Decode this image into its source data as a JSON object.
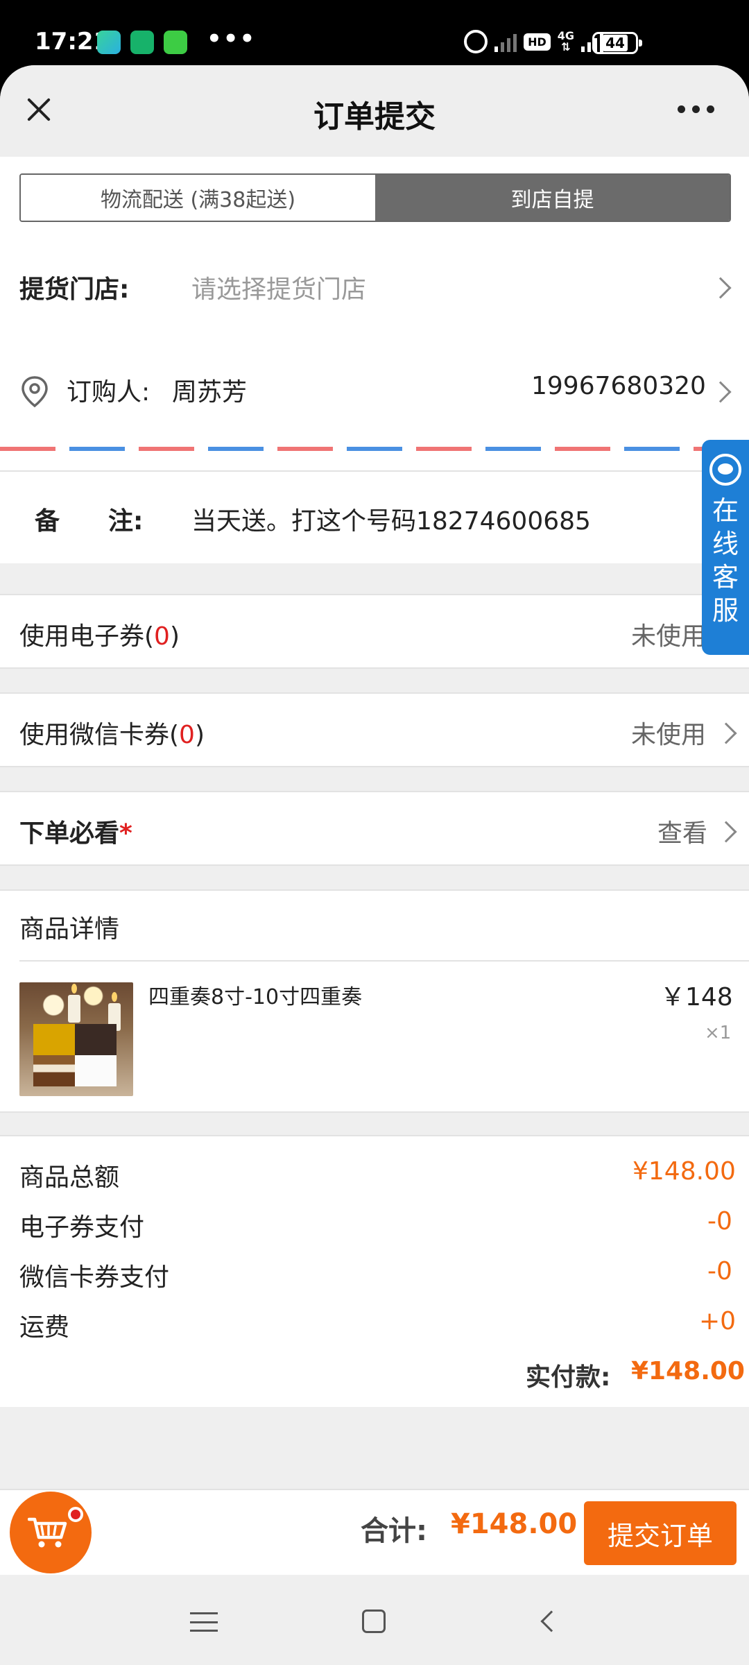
{
  "status_bar": {
    "time": "17:21",
    "more_glyph": "•••",
    "hd": "HD",
    "network": "4G",
    "battery": "44"
  },
  "header": {
    "title": "订单提交"
  },
  "delivery_tabs": [
    {
      "label": "物流配送 (满38起送)",
      "active": false
    },
    {
      "label": "到店自提",
      "active": true
    }
  ],
  "pickup_store": {
    "label": "提货门店:",
    "placeholder": "请选择提货门店"
  },
  "orderer": {
    "label": "订购人:",
    "name": "周苏芳",
    "phone": "19967680320"
  },
  "note": {
    "label_1": "备",
    "label_2": "注:",
    "value": "当天送。打这个号码18274600685"
  },
  "e_coupon": {
    "label": "使用电子券(",
    "count": "0",
    "close": ")",
    "status": "未使用"
  },
  "wechat_card": {
    "label": "使用微信卡券(",
    "count": "0",
    "close": ")",
    "status": "未使用"
  },
  "must_read": {
    "label": "下单必看",
    "star": "*",
    "action": "查看"
  },
  "customer_service": {
    "label": "在线客服"
  },
  "product_section": {
    "title": "商品详情",
    "items": [
      {
        "name": "四重奏8寸-10寸四重奏",
        "price": "￥148",
        "qty": "×1"
      }
    ]
  },
  "summary": {
    "rows": [
      {
        "label": "商品总额",
        "value": "¥148.00"
      },
      {
        "label": "电子券支付",
        "value": "-0"
      },
      {
        "label": "微信卡券支付",
        "value": "-0"
      },
      {
        "label": "运费",
        "value": "+0"
      }
    ],
    "paid_label": "实付款:",
    "paid_value": "¥148.00"
  },
  "footer": {
    "total_label": "合计:",
    "total_value": "¥148.00",
    "submit_label": "提交订单"
  },
  "colors": {
    "accent": "#f36a10",
    "tab_active": "#6b6b6b",
    "service_blue": "#1e7fd6",
    "count_red": "#e02020"
  }
}
